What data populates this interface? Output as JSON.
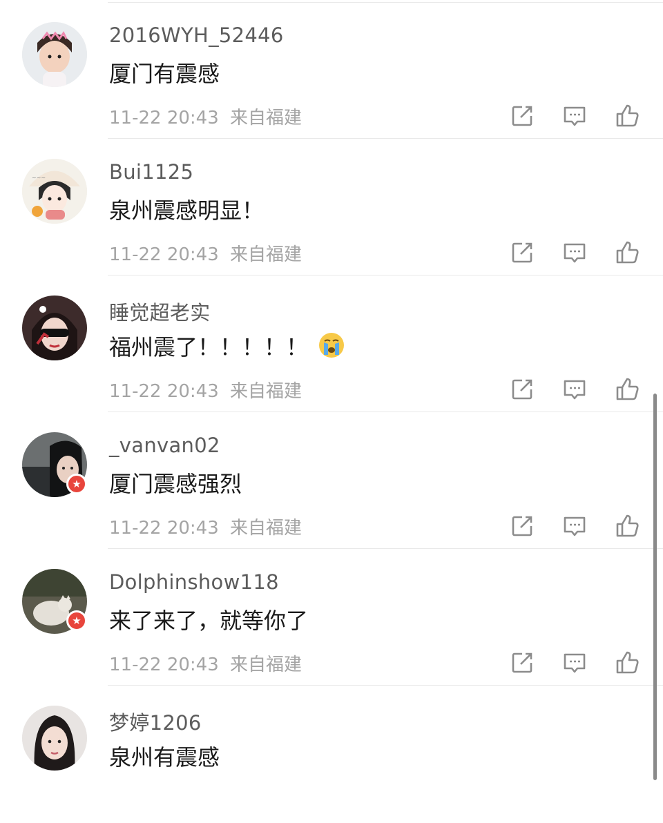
{
  "comments": [
    {
      "username": "2016WYH_52446",
      "text": "厦门有震感",
      "date": "11-22 20:43",
      "location": "来自福建",
      "emoji": ""
    },
    {
      "username": "Bui1125",
      "text": "泉州震感明显！",
      "date": "11-22 20:43",
      "location": "来自福建",
      "emoji": ""
    },
    {
      "username": "睡觉超老实",
      "text": "福州震了！！！！！",
      "date": "11-22 20:43",
      "location": "来自福建",
      "emoji": "crying-face"
    },
    {
      "username": "_vanvan02",
      "text": "厦门震感强烈",
      "date": "11-22 20:43",
      "location": "来自福建",
      "emoji": ""
    },
    {
      "username": "Dolphinshow118",
      "text": "来了来了，就等你了",
      "date": "11-22 20:43",
      "location": "来自福建",
      "emoji": ""
    },
    {
      "username": "梦婷1206",
      "text": "泉州有震感",
      "date": "",
      "location": "",
      "emoji": ""
    }
  ],
  "icons": {
    "share": "share-icon",
    "reply": "comment-icon",
    "like": "thumbs-up-icon",
    "badge": "vip-star-icon"
  },
  "colors": {
    "username": "#5c5c5c",
    "text": "#1a1a1a",
    "meta": "#a4a4a4",
    "icon": "#8c8c8c",
    "badge": "#e8453c"
  }
}
